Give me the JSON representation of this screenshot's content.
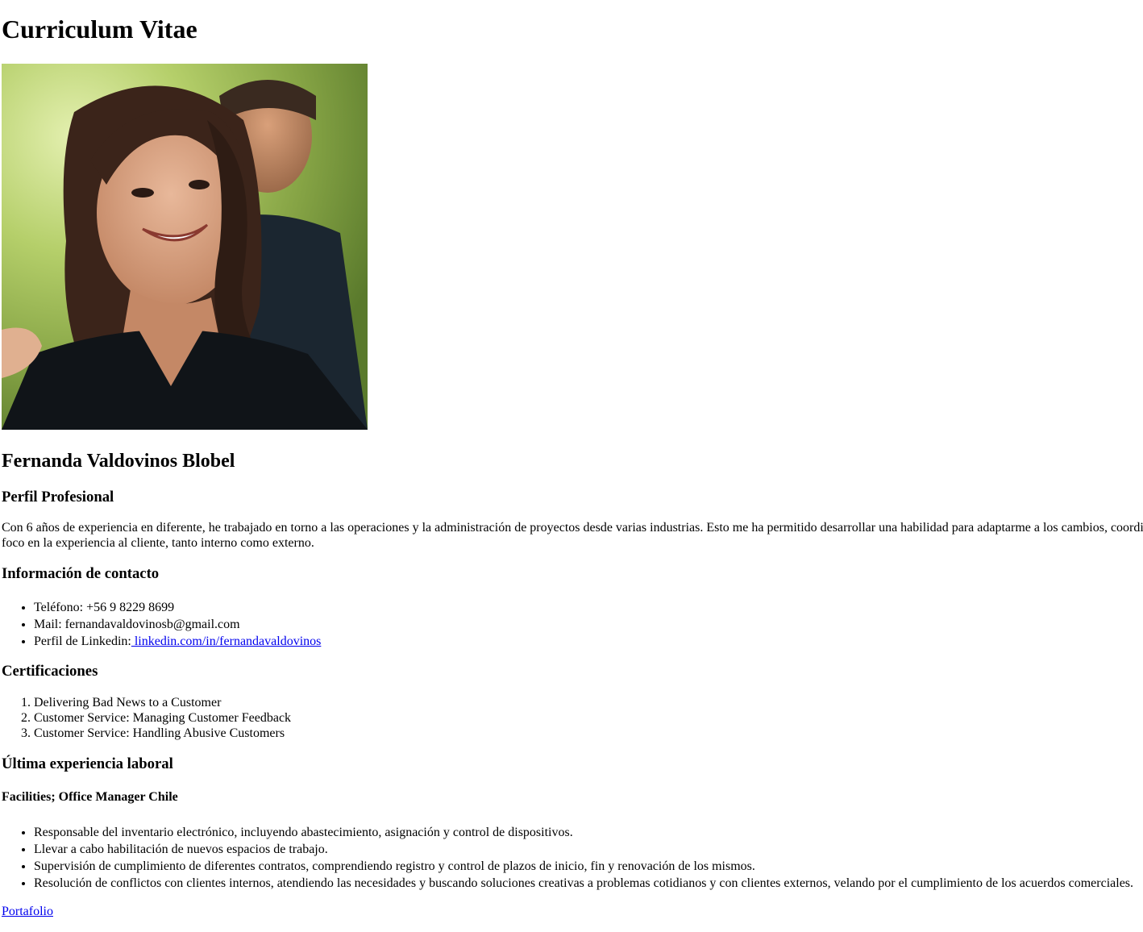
{
  "page_title": "Curriculum Vitae",
  "photo": {
    "icon": "profile-photo"
  },
  "name": "Fernanda Valdovinos Blobel",
  "perfil": {
    "heading": "Perfil Profesional",
    "line1": "Con 6 años de experiencia en diferente, he trabajado en torno a las operaciones y la administración de proyectos desde varias industrias. Esto me ha permitido desarrollar una habilidad para adaptarme a los cambios, coordi",
    "line2": "foco en la experiencia al cliente, tanto interno como externo."
  },
  "contacto": {
    "heading": "Información de contacto",
    "telefono": "Teléfono: +56 9 8229 8699",
    "mail": "Mail: fernandavaldovinosb@gmail.com",
    "linkedin_label": "Perfil de Linkedin:",
    "linkedin_link": " linkedin.com/in/fernandavaldovinos"
  },
  "certificaciones": {
    "heading": "Certificaciones",
    "items": [
      "Delivering Bad News to a Customer",
      "Customer Service: Managing Customer Feedback",
      "Customer Service: Handling Abusive Customers"
    ]
  },
  "experiencia": {
    "heading": "Última experiencia laboral",
    "role": "Facilities; Office Manager Chile",
    "items": [
      "Responsable del inventario electrónico, incluyendo abastecimiento, asignación y control de dispositivos.",
      "Llevar a cabo habilitación de nuevos espacios de trabajo.",
      "Supervisión de cumplimiento de diferentes contratos, comprendiendo registro y control de plazos de inicio, fin y renovación de los mismos.",
      "Resolución de conflictos con clientes internos, atendiendo las necesidades y buscando soluciones creativas a problemas cotidianos y con clientes externos, velando por el cumplimiento de los acuerdos comerciales."
    ]
  },
  "portfolio_link": "Portafolio",
  "colors": {
    "link": "#0000ee",
    "text": "#000000",
    "background": "#ffffff"
  }
}
